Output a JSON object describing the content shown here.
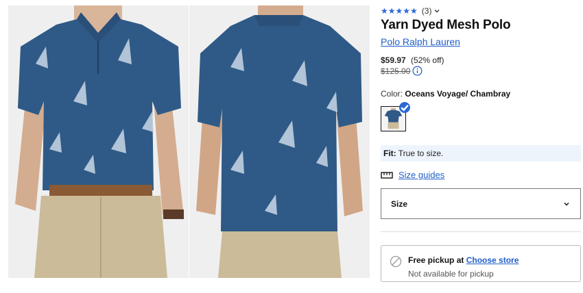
{
  "product": {
    "rating_stars": "★★★★★",
    "rating_count": "(3)",
    "title": "Yarn Dyed Mesh Polo",
    "brand": "Polo Ralph Lauren",
    "price": "$59.97",
    "discount": "(52% off)",
    "original_price": "$125.00",
    "color_label": "Color:",
    "color_name": "Oceans Voyage/ Chambray",
    "fit_label": "Fit:",
    "fit_value": "True to size.",
    "size_guides_label": "Size guides",
    "size_select_label": "Size"
  },
  "pickup": {
    "label": "Free pickup at",
    "choose_store": "Choose store",
    "status": "Not available for pickup"
  },
  "colors": {
    "accent": "#2a67d6",
    "link": "#1f5ec9",
    "shirt": "#2f5a87",
    "fit_bg": "#edf4fc"
  },
  "icons": [
    "chevron-down-icon",
    "info-icon",
    "check-icon",
    "ruler-icon",
    "unavailable-icon"
  ]
}
